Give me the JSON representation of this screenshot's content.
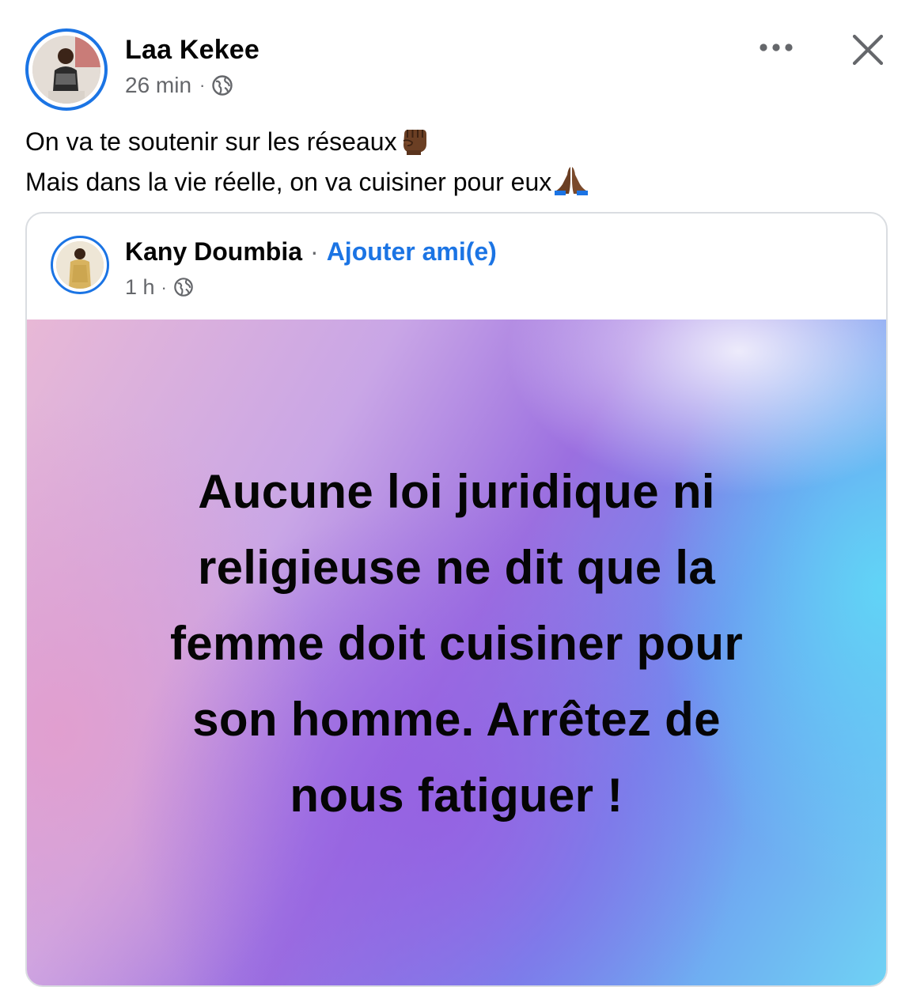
{
  "post": {
    "author_name": "Laa Kekee",
    "time": "26 min",
    "separator": "·",
    "audience_icon": "globe-icon",
    "more_icon": "more-options-icon",
    "close_icon": "close-icon",
    "caption_line1": "On va te soutenir sur les réseaux",
    "caption_line1_emoji": "raised-fist-emoji",
    "caption_line2": "Mais dans la vie réelle, on va cuisiner pour eux",
    "caption_line2_emoji": "folded-hands-emoji"
  },
  "shared_post": {
    "author_name": "Kany Doumbia",
    "separator": "·",
    "add_friend_label": "Ajouter ami(e)",
    "time": "1 h",
    "audience_icon": "globe-icon",
    "text_lines": [
      "Aucune loi juridique ni",
      "religieuse ne dit que la",
      "femme doit cuisiner pour",
      "son homme. Arrêtez de",
      "nous fatiguer !"
    ]
  },
  "colors": {
    "accent_blue": "#1b74e4",
    "secondary_text": "#65676b",
    "primary_text": "#050505",
    "card_border": "#dadde1"
  }
}
